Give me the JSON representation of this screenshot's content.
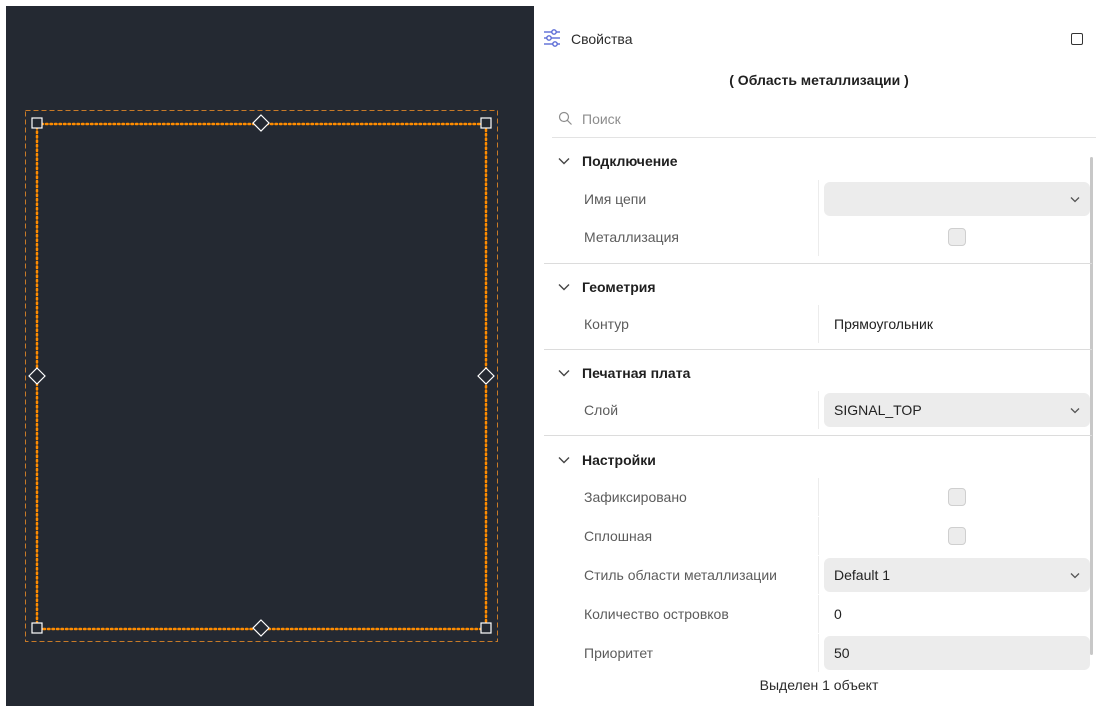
{
  "panel": {
    "title": "Свойства",
    "subtitle": "( Область металлизации )",
    "search_placeholder": "Поиск",
    "status": "Выделен 1 объект"
  },
  "sections": {
    "connection": {
      "label": "Подключение",
      "net_name_label": "Имя цепи",
      "net_name_value": "",
      "metallization_label": "Металлизация",
      "metallization_checked": false
    },
    "geometry": {
      "label": "Геометрия",
      "contour_label": "Контур",
      "contour_value": "Прямоугольник"
    },
    "pcb": {
      "label": "Печатная плата",
      "layer_label": "Слой",
      "layer_value": "SIGNAL_TOP"
    },
    "settings": {
      "label": "Настройки",
      "fixed_label": "Зафиксировано",
      "fixed_checked": false,
      "solid_label": "Сплошная",
      "solid_checked": false,
      "style_label": "Стиль области металлизации",
      "style_value": "Default 1",
      "islands_label": "Количество островков",
      "islands_value": "0",
      "priority_label": "Приоритет",
      "priority_value": "50"
    }
  },
  "colors": {
    "canvas_bg": "#242932",
    "selection_outline": "#ff8c00",
    "bounding_box": "#c87a28",
    "handle": "#ffffff"
  },
  "icons": {
    "panel": "properties-sliders-icon",
    "maximize": "maximize-icon",
    "search": "search-icon",
    "section_toggle": "chevron-down-icon",
    "dropdown": "chevron-down-icon"
  }
}
